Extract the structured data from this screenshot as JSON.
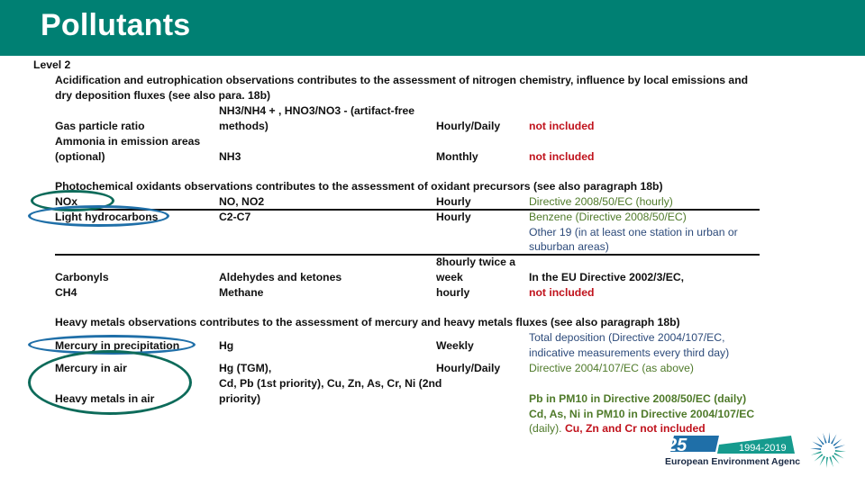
{
  "header": {
    "title": "Pollutants"
  },
  "level": "Level 2",
  "sections": [
    {
      "heading_lines": [
        "Acidification and eutrophication observations contributes to the assessment of nitrogen chemistry, influence by local emissions and",
        "dry deposition fluxes (see also para. 18b)"
      ],
      "rows": [
        {
          "name": "Gas particle ratio",
          "species_lines": [
            "NH3/NH4 + , HNO3/NO3 - (artifact-free",
            "methods)"
          ],
          "frequency": "Hourly/Daily",
          "status": "not included"
        },
        {
          "name_lines": [
            "Ammonia in emission areas",
            "(optional)"
          ],
          "species": "NH3",
          "frequency": "Monthly",
          "status": "not included"
        }
      ]
    },
    {
      "heading": "Photochemical oxidants observations contributes to the assessment of oxidant precursors (see also paragraph 18b)",
      "rows": [
        {
          "name": "NOx",
          "species": "NO, NO2",
          "frequency": "Hourly",
          "status": "Directive 2008/50/EC (hourly)"
        },
        {
          "name": "Light hydrocarbons",
          "species": "C2-C7",
          "frequency": "Hourly",
          "status_lines": [
            "Benzene (Directive 2008/50/EC)",
            "Other 19 (in at least one station in urban or",
            "suburban areas)"
          ]
        },
        {
          "name": "Carbonyls",
          "species": "Aldehydes and ketones",
          "frequency_lines": [
            "8hourly twice a",
            "week"
          ],
          "status": "In the EU Directive 2002/3/EC,"
        },
        {
          "name": "CH4",
          "species": "Methane",
          "frequency": "hourly",
          "status": "not included"
        }
      ]
    },
    {
      "heading": "Heavy metals observations contributes to the assessment of mercury and heavy metals fluxes (see also paragraph 18b)",
      "rows": [
        {
          "name": "Mercury in precipitation",
          "species": "Hg",
          "frequency": "Weekly",
          "status_lines": [
            "Total deposition (Directive 2004/107/EC,",
            "indicative measurements every third day)"
          ]
        },
        {
          "name": "Mercury in air",
          "species": "Hg (TGM),",
          "frequency": "Hourly/Daily",
          "status": "Directive 2004/107/EC (as above)"
        },
        {
          "name": "Heavy metals in air",
          "species_lines": [
            "Cd, Pb (1st priority), Cu, Zn, As, Cr, Ni (2nd",
            "priority)"
          ],
          "status_lines": [
            "Pb in PM10 in Directive 2008/50/EC (daily)",
            "Cd, As, Ni in PM10 in Directive 2004/107/EC"
          ],
          "status_tail": "(daily).",
          "status_tail_red": "Cu, Zn and Cr not included"
        }
      ]
    }
  ],
  "footer": {
    "logo_number": "25",
    "logo_years": "1994-2019",
    "logo_agency": "European Environment Agency",
    "logo_icon": "eea-sun-icon"
  },
  "colors": {
    "header_bg": "#008073",
    "not_included": "#c0121c",
    "directive_green": "#4f7a2a",
    "directive_blue": "#2c4a7a",
    "oval_blue": "#1f6fa8",
    "oval_green": "#0d6b5a"
  }
}
